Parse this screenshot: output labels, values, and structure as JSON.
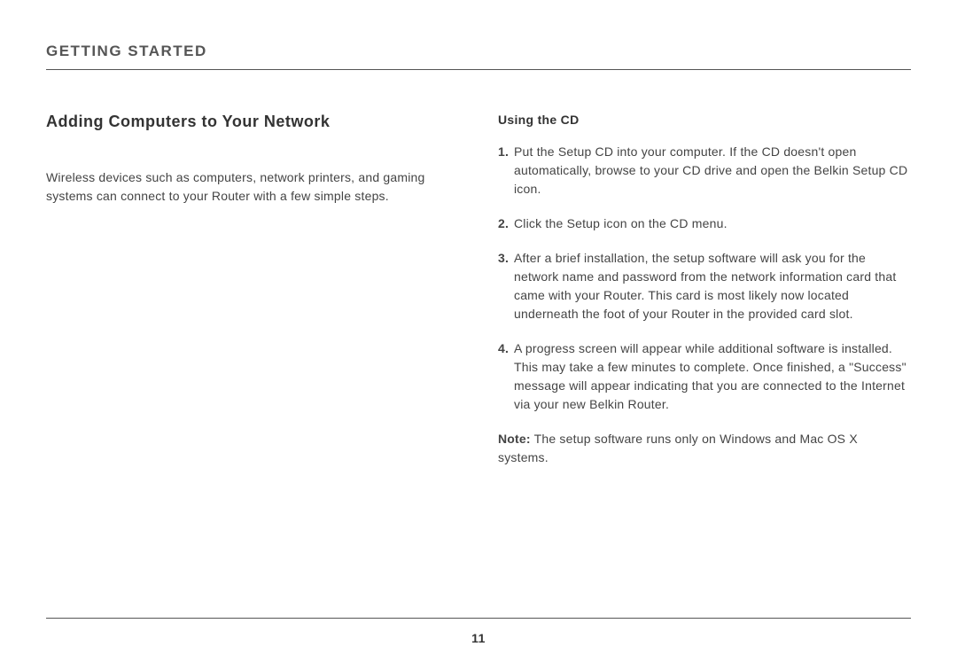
{
  "header": {
    "section": "GETTING STARTED"
  },
  "left": {
    "title": "Adding Computers to Your Network",
    "intro": "Wireless devices such as computers, network printers, and gaming systems can connect to your Router with a few simple steps."
  },
  "right": {
    "title": "Using the CD",
    "steps": [
      {
        "num": "1.",
        "text": "Put the Setup CD into your computer. If the CD doesn't open automatically, browse to your CD drive and open the Belkin Setup CD icon."
      },
      {
        "num": "2.",
        "text": "Click the Setup icon on the CD menu."
      },
      {
        "num": "3.",
        "text": "After a brief installation, the setup software will ask you for the network name and password from the network information card that came with your Router. This card is most likely now located underneath the foot of your Router in the provided card slot."
      },
      {
        "num": "4.",
        "text": "A progress screen will appear while additional software is installed. This may take a few minutes to complete. Once finished, a \"Success\" message will appear indicating that you are connected to the Internet via your new Belkin Router."
      }
    ],
    "note_label": "Note:",
    "note_text": " The setup software runs only on Windows and Mac OS X systems."
  },
  "footer": {
    "page_number": "11"
  }
}
